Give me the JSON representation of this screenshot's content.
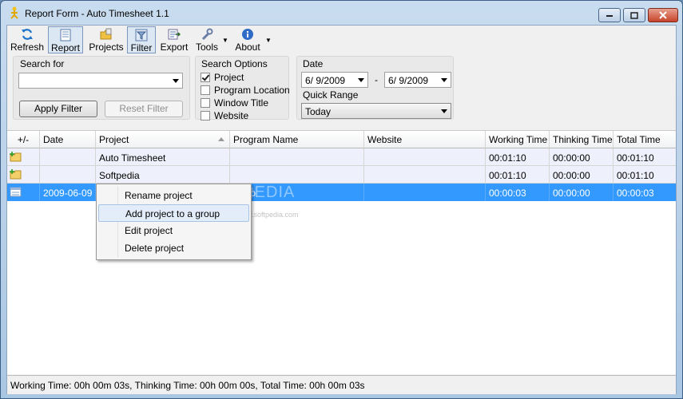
{
  "window": {
    "title": "Report Form - Auto Timesheet 1.1"
  },
  "toolbar": {
    "refresh": "Refresh",
    "report": "Report",
    "projects": "Projects",
    "filter": "Filter",
    "export": "Export",
    "tools": "Tools",
    "about": "About"
  },
  "search": {
    "label": "Search for",
    "value": "",
    "apply": "Apply Filter",
    "reset": "Reset Filter"
  },
  "search_options": {
    "label": "Search Options",
    "items": [
      {
        "label": "Project",
        "checked": true
      },
      {
        "label": "Program Location",
        "checked": false
      },
      {
        "label": "Window Title",
        "checked": false
      },
      {
        "label": "Website",
        "checked": false
      }
    ]
  },
  "date": {
    "label": "Date",
    "from": "6/ 9/2009",
    "separator": "-",
    "to": "6/ 9/2009",
    "quick_range_label": "Quick Range",
    "quick_range": "Today"
  },
  "grid": {
    "columns": [
      "+/-",
      "Date",
      "Project",
      "Program Name",
      "Website",
      "Working Time",
      "Thinking Time",
      "Total Time"
    ],
    "rows": [
      {
        "date": "",
        "project": "Auto Timesheet",
        "program": "",
        "website": "",
        "working": "00:01:10",
        "thinking": "00:00:00",
        "total": "00:01:10"
      },
      {
        "date": "",
        "project": "Softpedia",
        "program": "",
        "website": "",
        "working": "00:01:10",
        "thinking": "00:00:00",
        "total": "00:01:10"
      },
      {
        "date": "2009-06-09",
        "project": "",
        "program": "Snap",
        "website": "",
        "working": "00:00:03",
        "thinking": "00:00:00",
        "total": "00:00:03"
      }
    ]
  },
  "context_menu": {
    "items": [
      "Rename project",
      "Add project to a group",
      "Edit project",
      "Delete project"
    ],
    "highlighted": 1
  },
  "status": {
    "text": "Working Time: 00h 00m 03s, Thinking Time: 00h 00m 00s, Total Time: 00h 00m 03s"
  },
  "watermark": {
    "text": "SOFTPEDIA",
    "url": "www.softpedia.com"
  },
  "colors": {
    "selection": "#3399ff",
    "title_bar": "#b9d1ea",
    "close_button": "#c7432a"
  }
}
